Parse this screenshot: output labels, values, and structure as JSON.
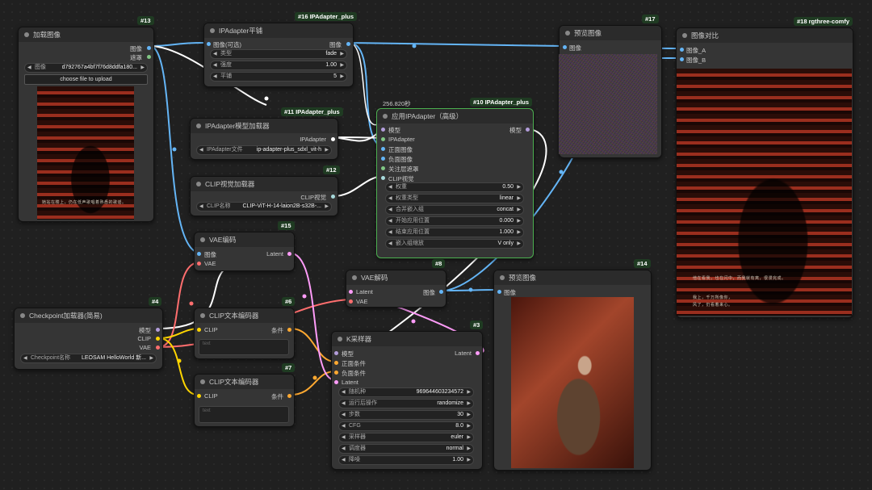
{
  "nodes": {
    "load_image": {
      "id": "#13",
      "title": "加载图像",
      "outputs": [
        "图像",
        "遮罩"
      ],
      "image_field": {
        "label": "图像",
        "value": "d792767a4bf7f76d8ddfa180..."
      },
      "upload_label": "choose file to upload",
      "caption": "她站在楼上，仍在低声歌唱着熟悉的歌谣。"
    },
    "ipa_tile": {
      "id": "#16 IPAdapter_plus",
      "title": "IPAdapter平铺",
      "input": "图像(可选)",
      "output": "图像",
      "widgets": [
        {
          "label": "类型",
          "value": "fade"
        },
        {
          "label": "强度",
          "value": "1.00"
        },
        {
          "label": "平铺",
          "value": "5"
        }
      ]
    },
    "ipa_model_loader": {
      "id": "#11 IPAdapter_plus",
      "title": "IPAdapter模型加载器",
      "output": "IPAdapter",
      "widget": {
        "label": "IPAdapter文件",
        "value": "ip-adapter-plus_sdxl_vit-h"
      }
    },
    "clip_vision_loader": {
      "id": "#12",
      "title": "CLIP视觉加载器",
      "output": "CLIP视觉",
      "widget": {
        "label": "CLIP名称",
        "value": "CLIP-ViT-H-14-laion2B-s32B-..."
      }
    },
    "apply_ipa": {
      "id": "#10 IPAdapter_plus",
      "timing": "256.820秒",
      "title": "应用IPAdapter（高级）",
      "inputs": [
        "模型",
        "IPAdapter",
        "正面图像",
        "负面图像",
        "关注层遮罩",
        "CLIP视觉"
      ],
      "output": "模型",
      "widgets": [
        {
          "label": "权重",
          "value": "0.50"
        },
        {
          "label": "权重类型",
          "value": "linear"
        },
        {
          "label": "合并嵌入组",
          "value": "concat"
        },
        {
          "label": "开始应用位置",
          "value": "0.000"
        },
        {
          "label": "结束应用位置",
          "value": "1.000"
        },
        {
          "label": "嵌入组缩放",
          "value": "V only"
        }
      ]
    },
    "preview_17": {
      "id": "#17",
      "title": "预览图像",
      "input": "图像"
    },
    "image_compare": {
      "id": "#18 rgthree-comfy",
      "title": "图像对比",
      "inputs": [
        "图像_A",
        "图像_B"
      ],
      "caption_line1": "他在看我，也在闪中，而我就有离，很漫完成。",
      "caption_line2": "我上，千万所像你，",
      "caption_line3": "风了，仍看着来心。"
    },
    "vae_encode": {
      "id": "#15",
      "title": "VAE编码",
      "inputs": [
        "图像",
        "VAE"
      ],
      "output": "Latent"
    },
    "vae_decode": {
      "id": "#8",
      "title": "VAE解码",
      "inputs": [
        "Latent",
        "VAE"
      ],
      "output": "图像"
    },
    "preview_14": {
      "id": "#14",
      "title": "预览图像",
      "input": "图像"
    },
    "checkpoint": {
      "id": "#4",
      "title": "Checkpoint加载器(简易)",
      "outputs": [
        "模型",
        "CLIP",
        "VAE"
      ],
      "widget": {
        "label": "Checkpoint名称",
        "value": "LEOSAM HelloWorld 新..."
      }
    },
    "clip_text_6": {
      "id": "#6",
      "title": "CLIP文本编码器",
      "input": "CLIP",
      "output": "条件",
      "placeholder": "text"
    },
    "clip_text_7": {
      "id": "#7",
      "title": "CLIP文本编码器",
      "input": "CLIP",
      "output": "条件",
      "placeholder": "text"
    },
    "ksampler": {
      "id": "#3",
      "title": "K采样器",
      "inputs": [
        "模型",
        "正面条件",
        "负面条件",
        "Latent"
      ],
      "output": "Latent",
      "widgets": [
        {
          "label": "随机种",
          "value": "969644603234572"
        },
        {
          "label": "运行后操作",
          "value": "randomize"
        },
        {
          "label": "步数",
          "value": "30"
        },
        {
          "label": "CFG",
          "value": "8.0"
        },
        {
          "label": "采样器",
          "value": "euler"
        },
        {
          "label": "调度器",
          "value": "normal"
        },
        {
          "label": "降噪",
          "value": "1.00"
        }
      ]
    }
  },
  "colors": {
    "image": "#64b5f6",
    "mask": "#81c784",
    "model": "#b39ddb",
    "clip": "#ffd500",
    "vae": "#ff6e6e",
    "latent": "#ff9cf9",
    "conditioning": "#ffa931",
    "ipadapter": "#ffffff",
    "clip_vision": "#a8dadc",
    "selected": "#4caf50"
  }
}
